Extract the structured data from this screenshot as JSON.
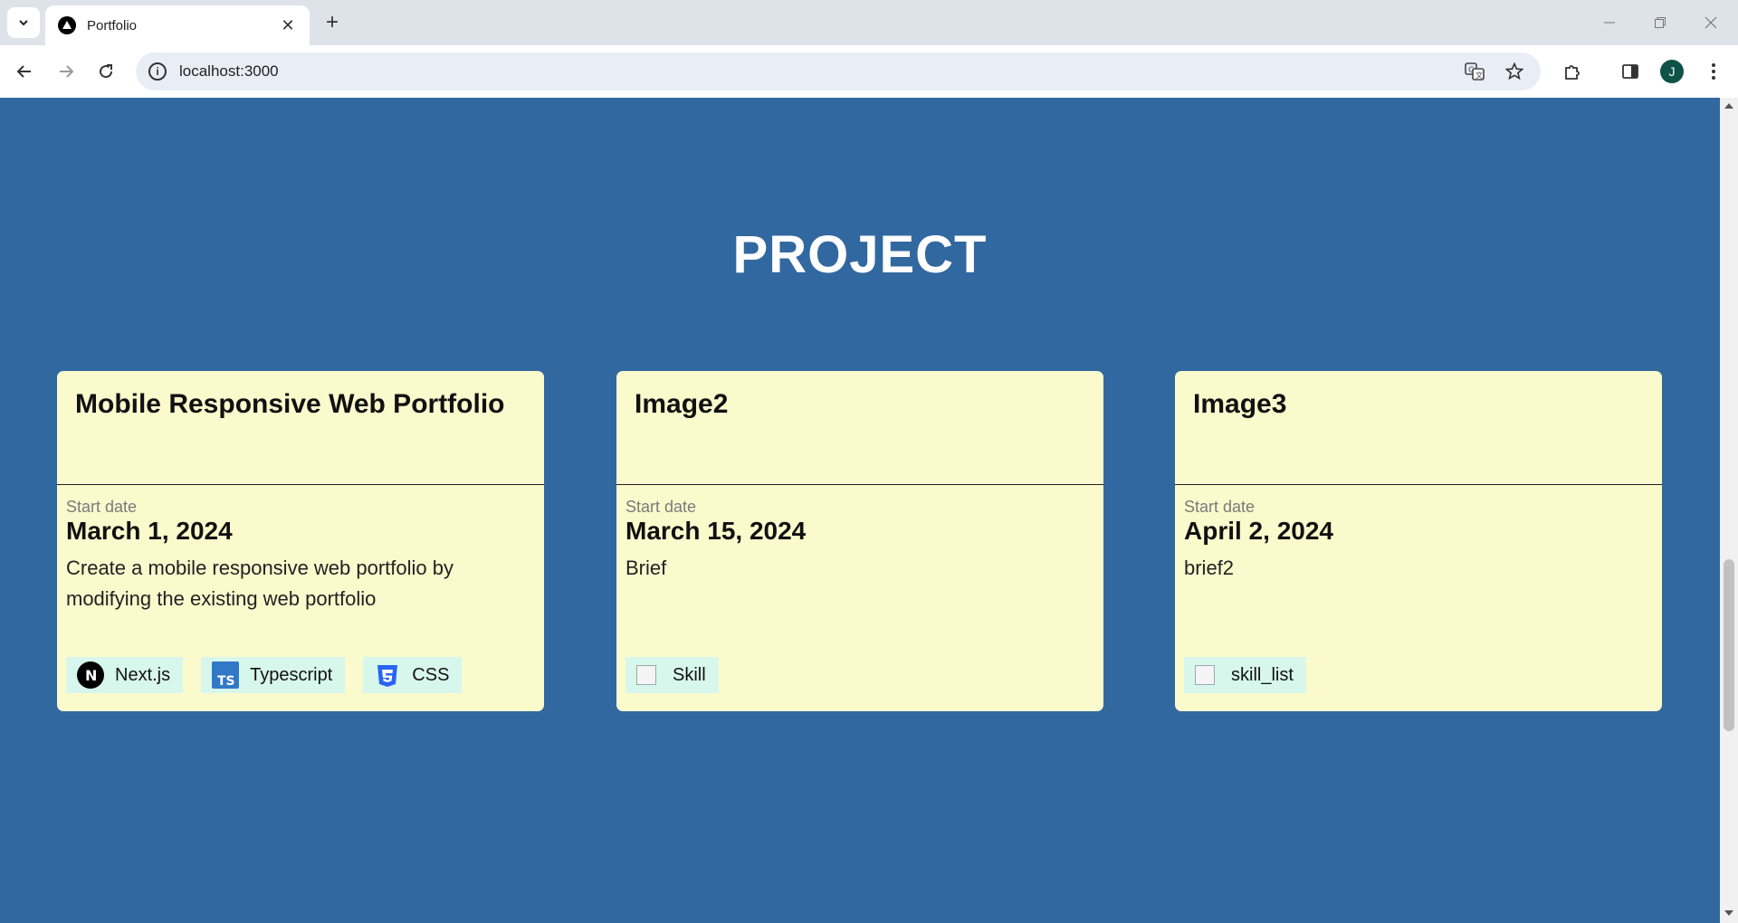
{
  "browser": {
    "tab_title": "Portfolio",
    "url": "localhost:3000",
    "profile_initial": "J"
  },
  "page": {
    "section_title": "PROJECT",
    "projects": [
      {
        "title": "Mobile Responsive Web Portfolio",
        "start_label": "Start date",
        "start_date": "March 1, 2024",
        "brief": "Create a mobile responsive web portfolio by modifying the existing web portfolio",
        "skills": [
          {
            "label": "Next.js",
            "icon": "nextjs-icon"
          },
          {
            "label": "Typescript",
            "icon": "typescript-icon"
          },
          {
            "label": "CSS",
            "icon": "css-icon"
          }
        ]
      },
      {
        "title": "Image2",
        "start_label": "Start date",
        "start_date": "March 15, 2024",
        "brief": "Brief",
        "skills": [
          {
            "label": "Skill",
            "icon": "broken-image-icon"
          }
        ]
      },
      {
        "title": "Image3",
        "start_label": "Start date",
        "start_date": "April 2, 2024",
        "brief": "brief2",
        "skills": [
          {
            "label": "skill_list",
            "icon": "broken-image-icon"
          }
        ]
      }
    ]
  },
  "colors": {
    "page_background": "#3268a0",
    "card_background": "#fbfacd",
    "skill_chip": "#d7f7ec"
  }
}
